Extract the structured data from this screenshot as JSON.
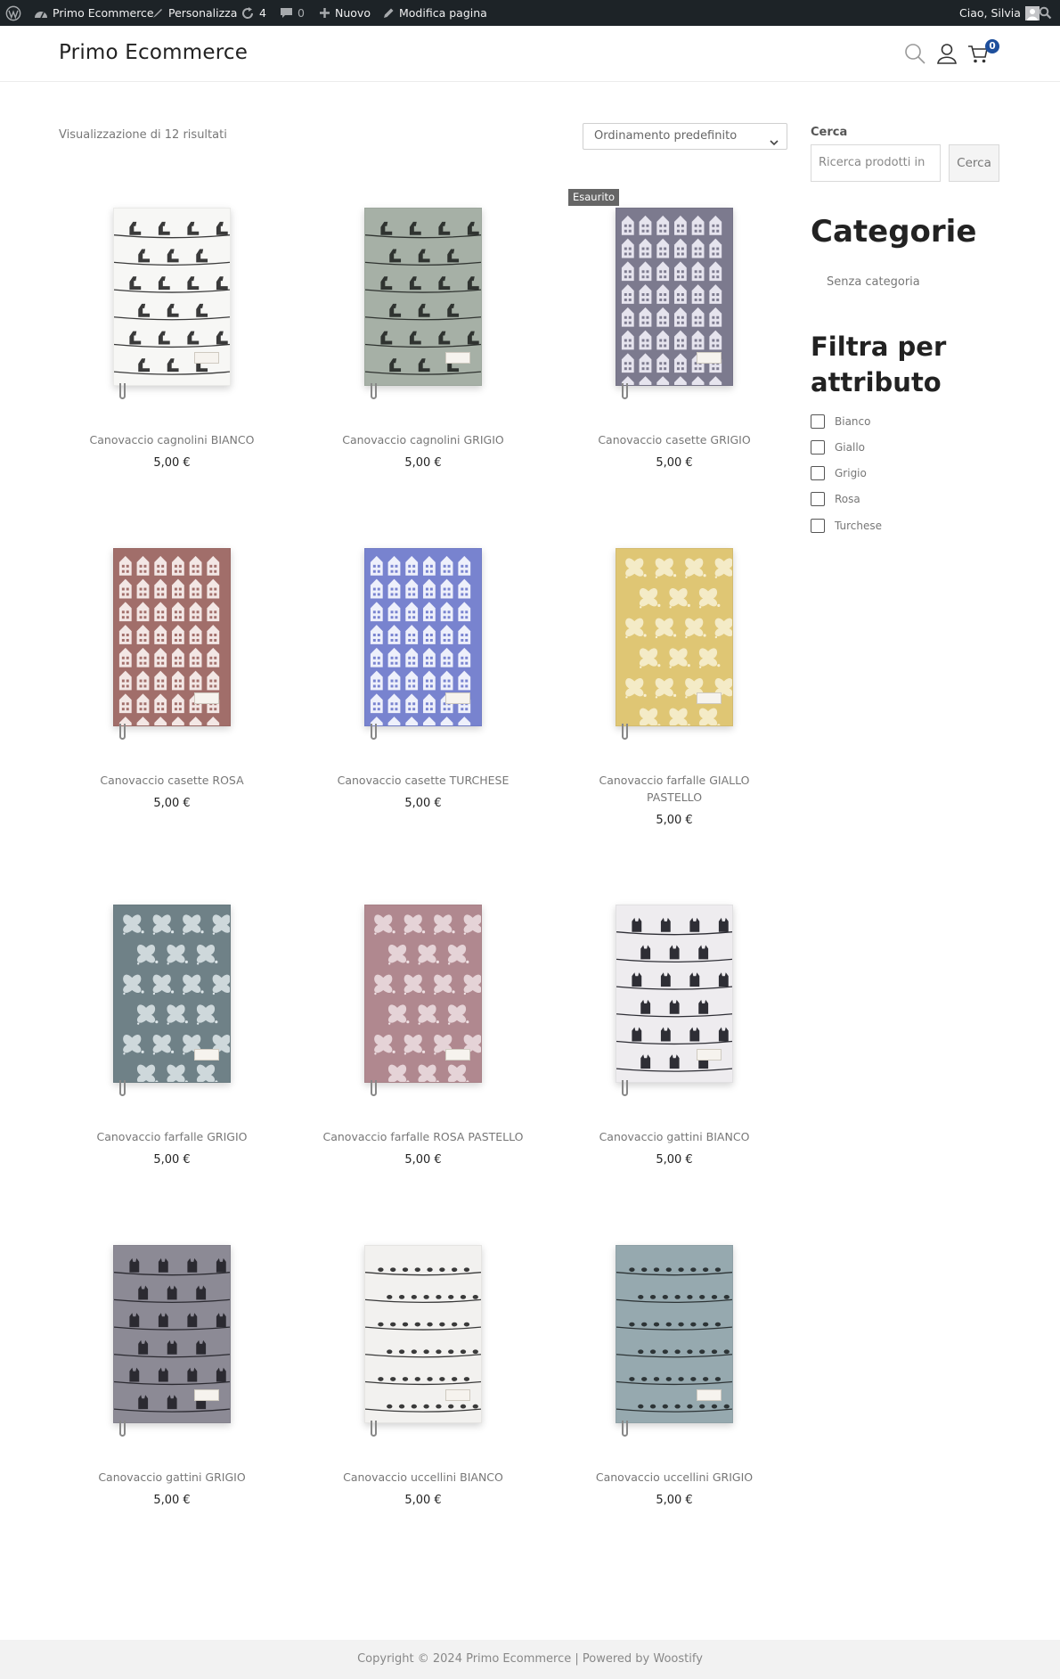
{
  "admin_bar": {
    "site_name": "Primo Ecommerce",
    "customize": "Personalizza",
    "updates_count": "4",
    "comments_count": "0",
    "new": "Nuovo",
    "edit_page": "Modifica pagina",
    "greeting": "Ciao, Silvia"
  },
  "header": {
    "site_title": "Primo Ecommerce",
    "cart_count": "0"
  },
  "shop": {
    "result_count": "Visualizzazione di 12 risultati",
    "orderby_selected": "Ordinamento predefinito",
    "out_of_stock_badge": "Esaurito",
    "products": [
      {
        "name": "Canovaccio cagnolini BIANCO",
        "price": "5,00 €",
        "bg": "#f7f7f5",
        "fg": "#3a3a3a",
        "pattern": "dogs"
      },
      {
        "name": "Canovaccio cagnolini GRIGIO",
        "price": "5,00 €",
        "bg": "#a6b0a6",
        "fg": "#2f3330",
        "pattern": "dogs"
      },
      {
        "name": "Canovaccio casette GRIGIO",
        "price": "5,00 €",
        "bg": "#7c7a8e",
        "fg": "#e6e4ee",
        "pattern": "houses"
      },
      {
        "name": "Canovaccio casette ROSA",
        "price": "5,00 €",
        "bg": "#a16e6a",
        "fg": "#f3e7e5",
        "pattern": "houses"
      },
      {
        "name": "Canovaccio casette TURCHESE",
        "price": "5,00 €",
        "bg": "#7883cf",
        "fg": "#eef0fb",
        "pattern": "houses"
      },
      {
        "name": "Canovaccio farfalle GIALLO PASTELLO",
        "price": "5,00 €",
        "bg": "#dfc674",
        "fg": "#f8f1d6",
        "pattern": "butterflies"
      },
      {
        "name": "Canovaccio farfalle GRIGIO",
        "price": "5,00 €",
        "bg": "#6f8187",
        "fg": "#dfe7ea",
        "pattern": "butterflies"
      },
      {
        "name": "Canovaccio farfalle ROSA PASTELLO",
        "price": "5,00 €",
        "bg": "#b0888f",
        "fg": "#efe1e4",
        "pattern": "butterflies"
      },
      {
        "name": "Canovaccio gattini BIANCO",
        "price": "5,00 €",
        "bg": "#eeecef",
        "fg": "#2e2e35",
        "pattern": "cats"
      },
      {
        "name": "Canovaccio gattini GRIGIO",
        "price": "5,00 €",
        "bg": "#8c8a95",
        "fg": "#2b2a31",
        "pattern": "cats"
      },
      {
        "name": "Canovaccio uccellini BIANCO",
        "price": "5,00 €",
        "bg": "#f2f1ef",
        "fg": "#3a3a3a",
        "pattern": "birds"
      },
      {
        "name": "Canovaccio uccellini GRIGIO",
        "price": "5,00 €",
        "bg": "#96a9af",
        "fg": "#2d3436",
        "pattern": "birds"
      }
    ]
  },
  "sidebar": {
    "search_label": "Cerca",
    "search_placeholder": "Ricerca prodotti in",
    "search_button": "Cerca",
    "categories_heading": "Categorie",
    "categories": [
      "Senza categoria"
    ],
    "filter_heading_line1": "Filtra per",
    "filter_heading_line2": "attributo",
    "filters": [
      "Bianco",
      "Giallo",
      "Grigio",
      "Rosa",
      "Turchese"
    ]
  },
  "footer": {
    "text": "Copyright © 2024 Primo Ecommerce | Powered by Woostify"
  },
  "colors": {
    "admin_bar_bg": "#1d2327",
    "cart_badge": "#1e4f9c",
    "footer_bg": "#f2f2f2"
  }
}
